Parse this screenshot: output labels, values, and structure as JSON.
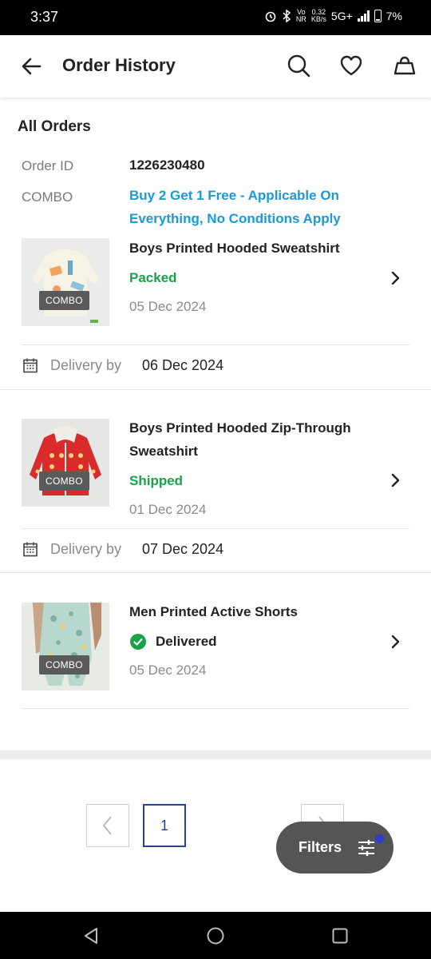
{
  "status_bar": {
    "time": "3:37",
    "speed": "0.32",
    "speed_unit": "KB/s",
    "network": "5G+",
    "battery": "7%"
  },
  "header": {
    "title": "Order History"
  },
  "section": {
    "title": "All Orders"
  },
  "order": {
    "id_label": "Order ID",
    "id_value": "1226230480",
    "combo_label": "COMBO",
    "offer_text": "Buy 2 Get 1 Free - Applicable On Everything, No Conditions Apply"
  },
  "items": [
    {
      "tag": "COMBO",
      "name": "Boys Printed Hooded Sweatshirt",
      "status": "Packed",
      "status_color": "#18a349",
      "date": "05 Dec 2024",
      "delivery_label": "Delivery by",
      "delivery_date": "06 Dec 2024"
    },
    {
      "tag": "COMBO",
      "name": "Boys Printed Hooded Zip-Through Sweatshirt",
      "status": "Shipped",
      "status_color": "#18a349",
      "date": "01 Dec 2024",
      "delivery_label": "Delivery by",
      "delivery_date": "07 Dec 2024"
    },
    {
      "tag": "COMBO",
      "name": "Men Printed Active Shorts",
      "status": "Delivered",
      "status_color": "#222222",
      "date": "05 Dec 2024"
    }
  ],
  "pagination": {
    "current_page": "1"
  },
  "filters": {
    "label": "Filters"
  },
  "icons": [
    "back-arrow-icon",
    "search-icon",
    "heart-icon",
    "bag-icon",
    "calendar-icon",
    "chevron-right-icon",
    "check-circle-icon",
    "sliders-icon",
    "nav-back-icon",
    "nav-home-icon",
    "nav-recents-icon"
  ]
}
